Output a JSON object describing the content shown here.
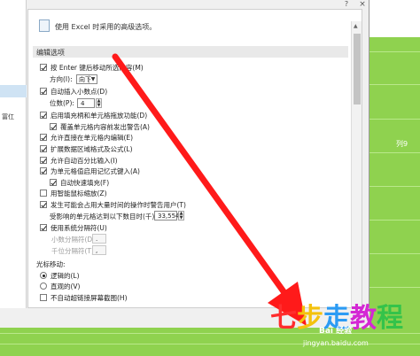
{
  "sheet": {
    "column_label": "列9"
  },
  "dialog": {
    "help_label": "?",
    "close_label": "×",
    "left_nav_text": "冨仜",
    "header": "使用 Excel 时采用的高级选项。",
    "section_title": "编辑选项",
    "options": {
      "move_after_enter": {
        "label": "按 Enter 键后移动所选内容(M)",
        "checked": true
      },
      "direction": {
        "label": "方向(I):",
        "value": "向下"
      },
      "auto_decimal": {
        "label": "自动插入小数点(D)",
        "checked": true
      },
      "places": {
        "label": "位数(P):",
        "value": "4"
      },
      "fill_handle": {
        "label": "启用填充柄和单元格拖放功能(D)",
        "checked": true
      },
      "alert_overwrite": {
        "label": "覆盖单元格内容前发出警告(A)",
        "checked": true
      },
      "edit_in_cell": {
        "label": "允许直接在单元格内编辑(E)",
        "checked": true
      },
      "extend_formats": {
        "label": "扩展数据区域格式及公式(L)",
        "checked": true
      },
      "auto_percent": {
        "label": "允许自动百分比输入(I)",
        "checked": true
      },
      "autocomplete": {
        "label": "为单元格值启用记忆式键入(A)",
        "checked": true
      },
      "flash_fill": {
        "label": "自动快速填充(F)",
        "checked": true
      },
      "intellimouse": {
        "label": "用智能鼠标缩放(Z)",
        "checked": false
      },
      "alert_slow": {
        "label": "发生可能会占用大量时间的操作时警告用户(T)",
        "checked": true
      },
      "cells_threshold": {
        "label": "受影响的单元格达到以下数目时(千)(U):",
        "value": "33,554"
      },
      "system_separators": {
        "label": "使用系统分隔符(U)",
        "checked": true
      },
      "decimal_sep": {
        "label": "小数分隔符(D):",
        "value": "."
      },
      "thousands_sep": {
        "label": "千位分隔符(T):",
        "value": ","
      },
      "cursor_movement": {
        "label": "光标移动:"
      },
      "logical": {
        "label": "逻辑的(L)",
        "checked": true
      },
      "visual": {
        "label": "直观的(V)",
        "checked": false
      },
      "no_hyperlink_screenshot": {
        "label": "不自动超链接屏幕截图(H)",
        "checked": false
      }
    },
    "spinner_up": "▲",
    "spinner_down": "▼",
    "select_arrow": "▼"
  },
  "watermark": {
    "chars": [
      "七",
      "步",
      "走",
      "教",
      "程"
    ],
    "brand": "Bai 经验",
    "url": "jingyan.baidu.com"
  },
  "colors": {
    "sheet_green": "#8fd24f",
    "arrow_red": "#ff1a1a",
    "selection_blue": "#cfe3f4"
  }
}
